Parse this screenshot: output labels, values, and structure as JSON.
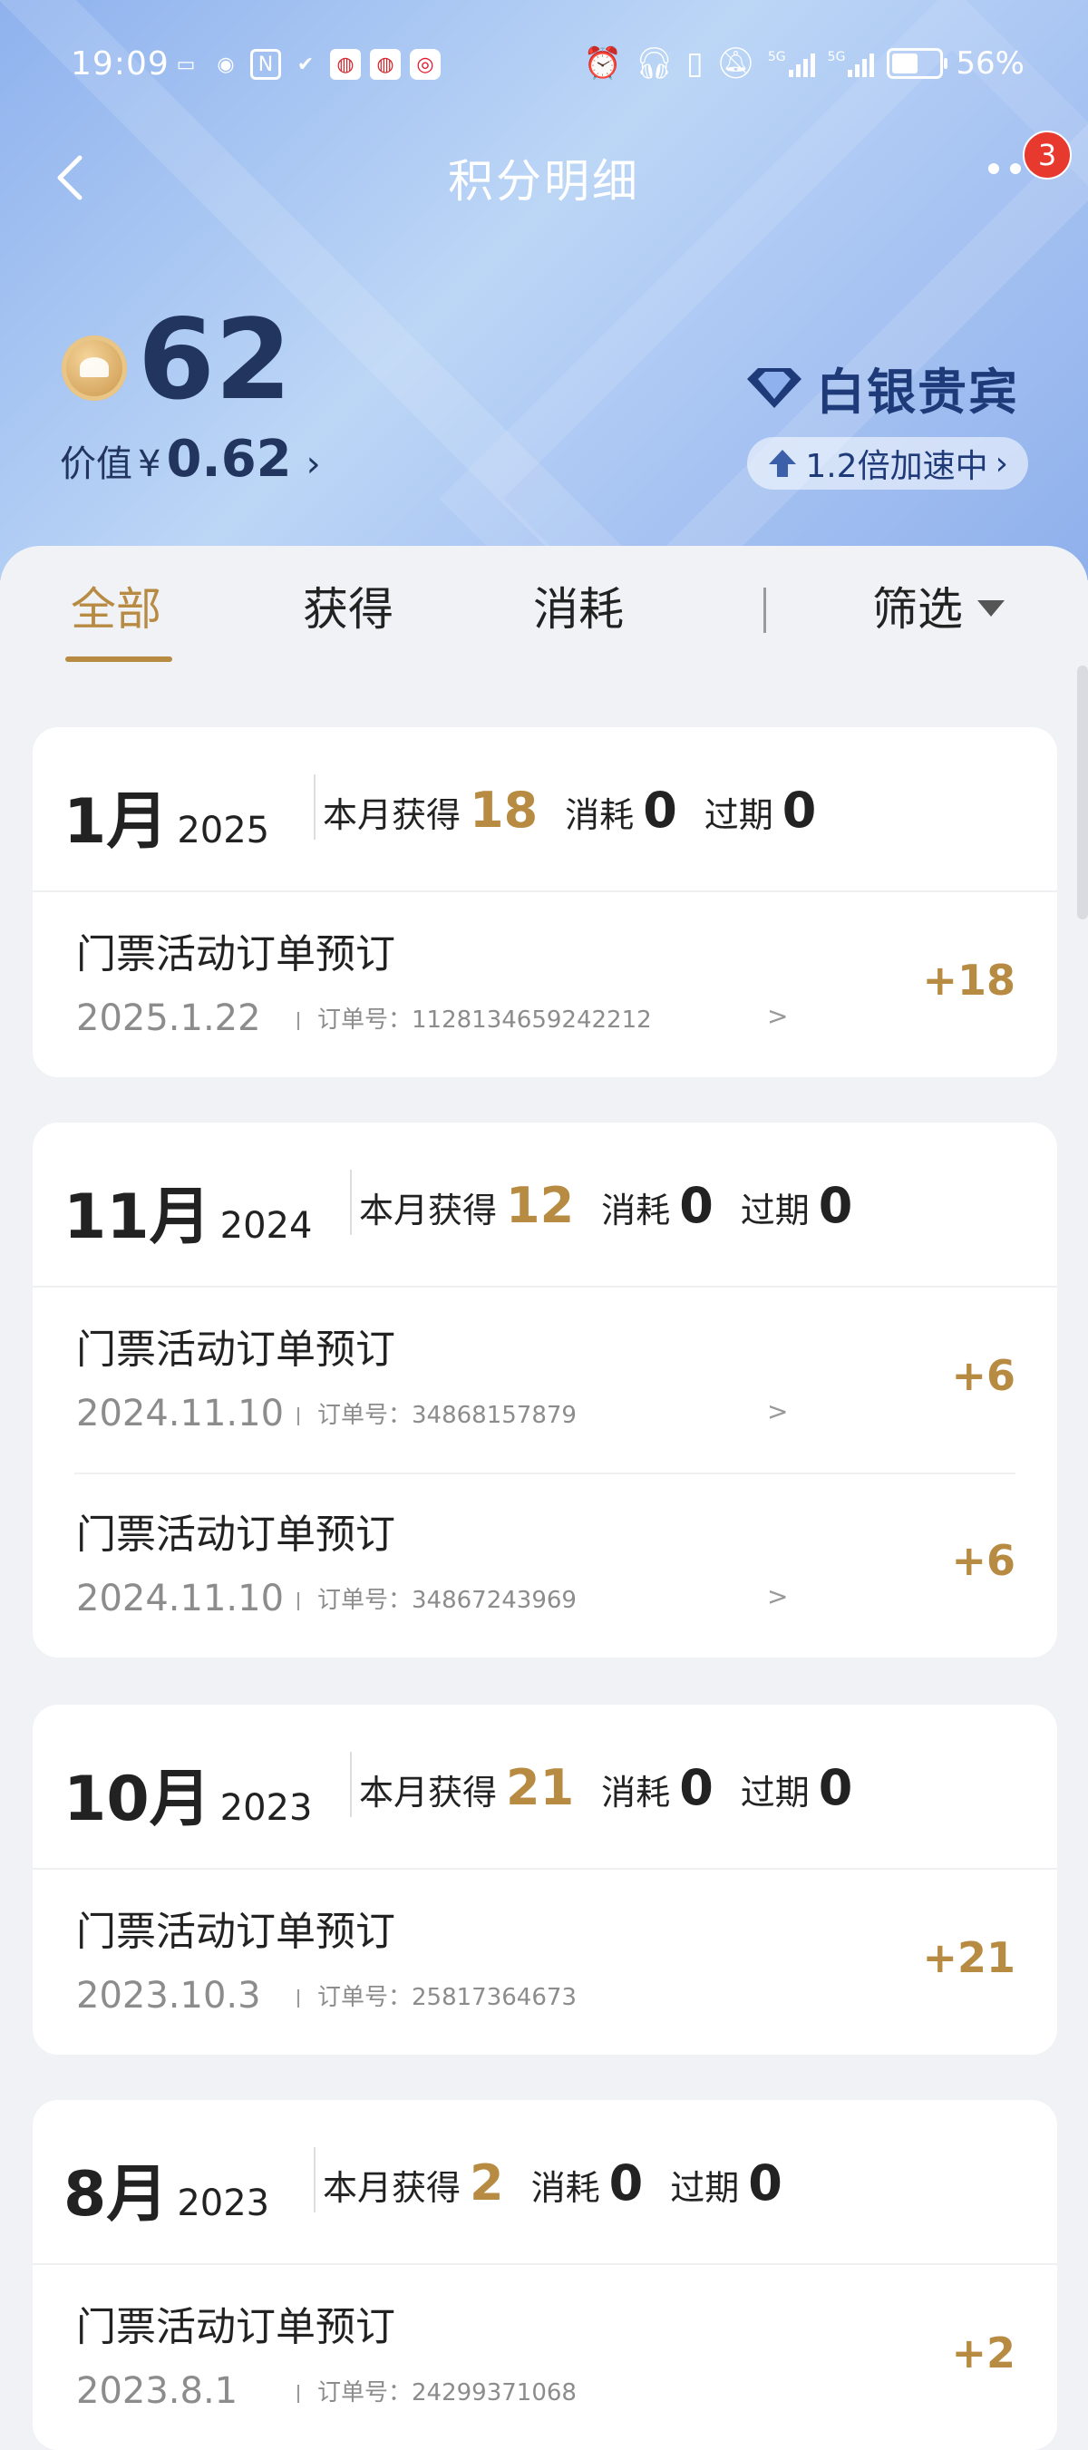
{
  "status_bar": {
    "time": "19:09",
    "battery": "56%",
    "network_1": "5G",
    "network_2": "5G",
    "battery_level": 0.56
  },
  "nav": {
    "title": "积分明细",
    "badge_count": "3"
  },
  "summary": {
    "points": "62",
    "value_label": "价值",
    "value_currency": "¥",
    "value_amount": "0.62",
    "vip_level": "白银贵宾",
    "boost_text": "1.2倍加速中"
  },
  "tabs": {
    "all": "全部",
    "earned": "获得",
    "consumed": "消耗",
    "filter": "筛选"
  },
  "labels": {
    "month_earned": "本月获得",
    "consumed": "消耗",
    "expired": "过期",
    "order_prefix": "订单号：",
    "chevron": ">"
  },
  "months": [
    {
      "month": "1月",
      "year": "2025",
      "earned": "18",
      "consumed": "0",
      "expired": "0",
      "records": [
        {
          "title": "门票活动订单预订",
          "date": "2025.1.22",
          "order_no": "1128134659242212",
          "points": "+18",
          "has_arrow": true
        }
      ]
    },
    {
      "month": "11月",
      "year": "2024",
      "earned": "12",
      "consumed": "0",
      "expired": "0",
      "records": [
        {
          "title": "门票活动订单预订",
          "date": "2024.11.10",
          "order_no": "34868157879",
          "points": "+6",
          "has_arrow": true
        },
        {
          "title": "门票活动订单预订",
          "date": "2024.11.10",
          "order_no": "34867243969",
          "points": "+6",
          "has_arrow": true
        }
      ]
    },
    {
      "month": "10月",
      "year": "2023",
      "earned": "21",
      "consumed": "0",
      "expired": "0",
      "records": [
        {
          "title": "门票活动订单预订",
          "date": "2023.10.3",
          "order_no": "25817364673",
          "points": "+21",
          "has_arrow": false
        }
      ]
    },
    {
      "month": "8月",
      "year": "2023",
      "earned": "2",
      "consumed": "0",
      "expired": "0",
      "records": [
        {
          "title": "门票活动订单预订",
          "date": "2023.8.1",
          "order_no": "24299371068",
          "points": "+2",
          "has_arrow": false
        }
      ]
    }
  ],
  "colors": {
    "accent_gold": "#b88b43",
    "navy": "#22355f",
    "badge_red": "#e8392f"
  }
}
